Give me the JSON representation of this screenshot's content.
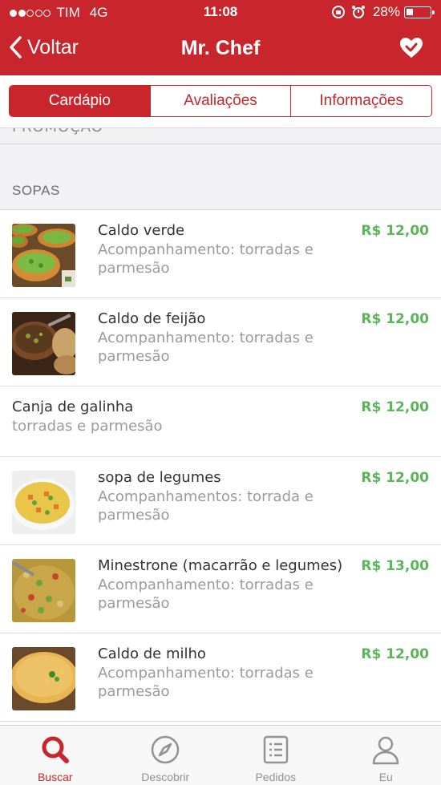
{
  "status_bar": {
    "carrier": "TIM",
    "network": "4G",
    "time": "11:08",
    "battery": "28%"
  },
  "nav": {
    "back_label": "Voltar",
    "title": "Mr. Chef"
  },
  "tabs": [
    {
      "label": "Cardápio",
      "active": true
    },
    {
      "label": "Avaliações",
      "active": false
    },
    {
      "label": "Informações",
      "active": false
    }
  ],
  "previous_section_cut": "PROMOÇÃO",
  "section": {
    "title": "SOPAS",
    "items": [
      {
        "name": "Caldo verde",
        "desc": "Acompanhamento: torradas e parmesão",
        "price": "R$ 12,00",
        "has_image": true,
        "image": "green-soup-bowls"
      },
      {
        "name": "Caldo de feijão",
        "desc": "Acompanhamento: torradas e parmesão",
        "price": "R$ 12,00",
        "has_image": true,
        "image": "bean-soup"
      },
      {
        "name": "Canja de galinha",
        "desc": "torradas e parmesão",
        "price": "R$ 12,00",
        "has_image": false
      },
      {
        "name": "sopa de legumes",
        "desc": "Acompanhamentos: torrada e parmesão",
        "price": "R$ 12,00",
        "has_image": true,
        "image": "vegetable-soup"
      },
      {
        "name": "Minestrone (macarrão e legumes)",
        "desc": "Acompanhamento: torradas e parmesão",
        "price": "R$ 13,00",
        "has_image": true,
        "image": "minestrone"
      },
      {
        "name": "Caldo de milho",
        "desc": "Acompanhamento: torradas e parmesão",
        "price": "R$ 12,00",
        "has_image": true,
        "image": "corn-soup"
      }
    ]
  },
  "tab_bar": [
    {
      "label": "Buscar",
      "icon": "search-icon",
      "active": true
    },
    {
      "label": "Descobrir",
      "icon": "compass-icon",
      "active": false
    },
    {
      "label": "Pedidos",
      "icon": "receipt-icon",
      "active": false
    },
    {
      "label": "Eu",
      "icon": "person-icon",
      "active": false
    }
  ],
  "colors": {
    "brand": "#c8262c",
    "price": "#5cb45c"
  }
}
